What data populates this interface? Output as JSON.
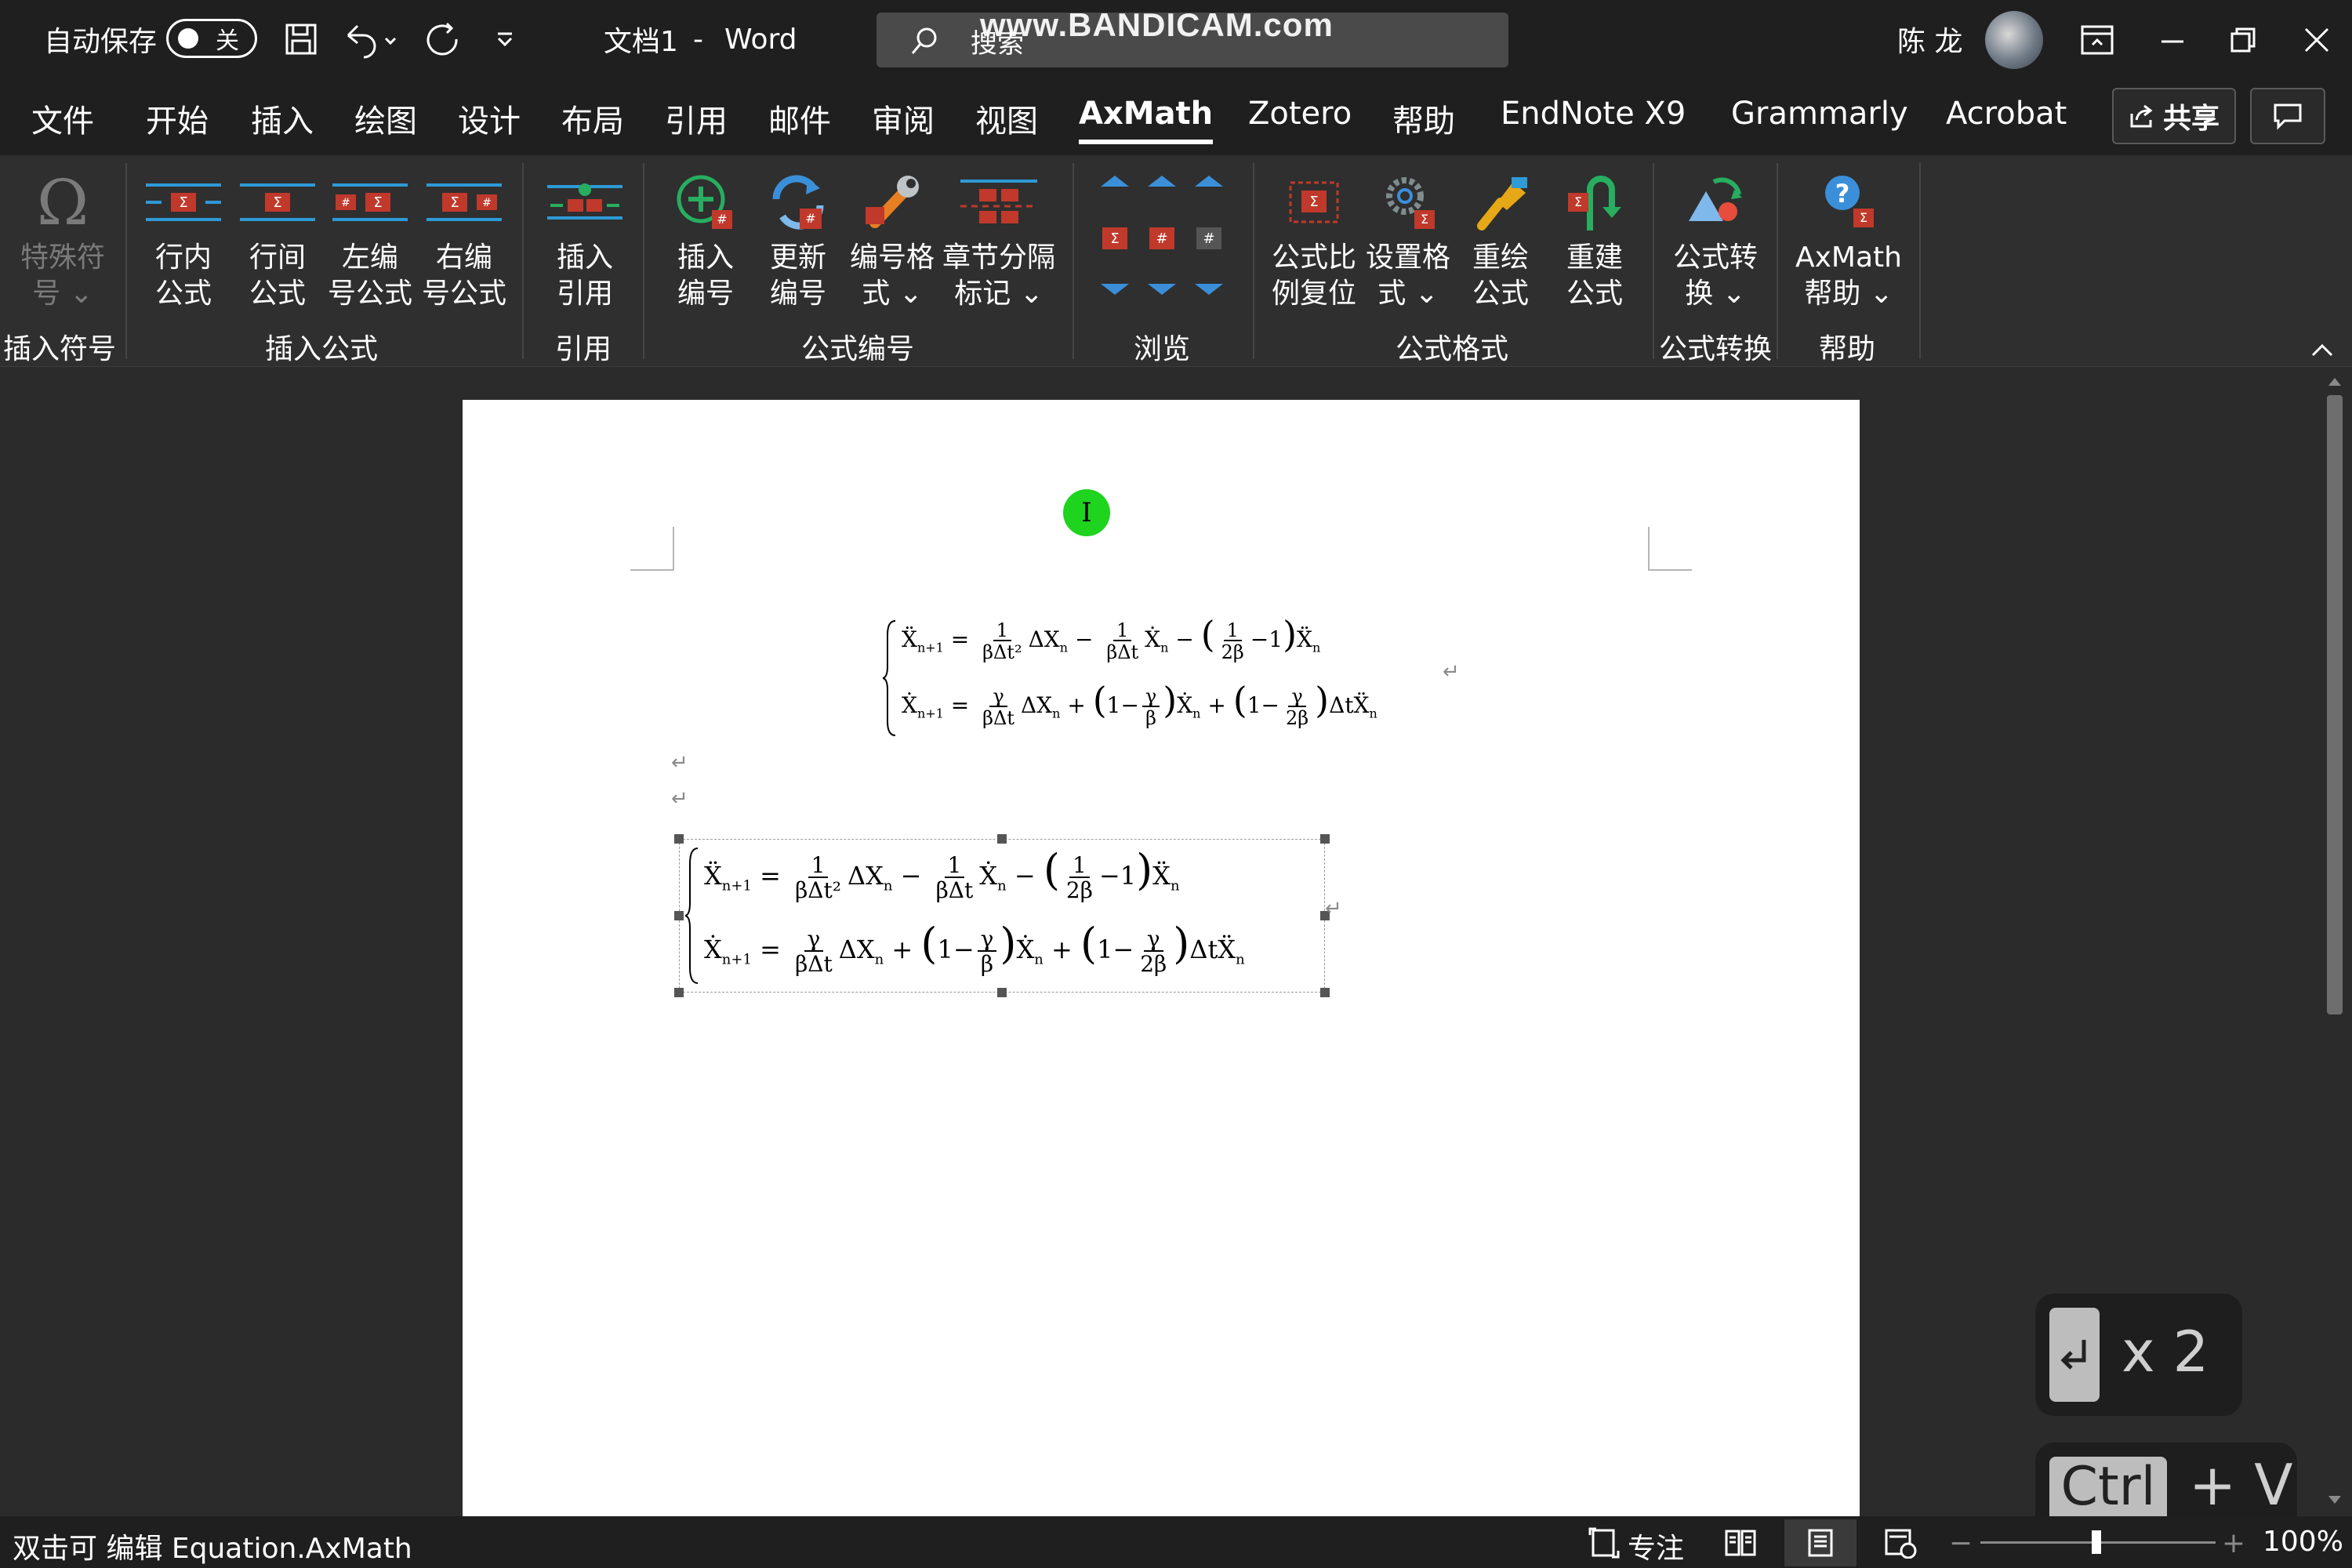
{
  "titlebar": {
    "autosave_label": "自动保存",
    "autosave_state": "关",
    "doc_title": "文档1",
    "title_sep": "-",
    "app_name": "Word",
    "search_placeholder": "搜索",
    "watermark": "www.BANDICAM.com",
    "user_name": "陈 龙"
  },
  "tabs": [
    "文件",
    "开始",
    "插入",
    "绘图",
    "设计",
    "布局",
    "引用",
    "邮件",
    "审阅",
    "视图",
    "AxMath",
    "Zotero",
    "帮助",
    "EndNote X9",
    "Grammarly",
    "Acrobat"
  ],
  "active_tab": "AxMath",
  "share_label": "共享",
  "ribbon": {
    "special_symbol": {
      "line1": "特殊符",
      "line2": "号 ⌄"
    },
    "inline_formula": {
      "line1": "行内",
      "line2": "公式"
    },
    "display_formula": {
      "line1": "行间",
      "line2": "公式"
    },
    "left_numbered": {
      "line1": "左编",
      "line2": "号公式"
    },
    "right_numbered": {
      "line1": "右编",
      "line2": "号公式"
    },
    "insert_ref": {
      "line1": "插入",
      "line2": "引用"
    },
    "insert_number": {
      "line1": "插入",
      "line2": "编号"
    },
    "update_number": {
      "line1": "更新",
      "line2": "编号"
    },
    "number_format": {
      "line1": "编号格",
      "line2": "式 ⌄"
    },
    "chapter_mark": {
      "line1": "章节分隔",
      "line2": "标记 ⌄"
    },
    "scale_reset": {
      "line1": "公式比",
      "line2": "例复位"
    },
    "set_format": {
      "line1": "设置格",
      "line2": "式 ⌄"
    },
    "redraw": {
      "line1": "重绘",
      "line2": "公式"
    },
    "rebuild": {
      "line1": "重建",
      "line2": "公式"
    },
    "convert": {
      "line1": "公式转",
      "line2": "换 ⌄"
    },
    "help": {
      "line1": "AxMath",
      "line2": "帮助 ⌄"
    },
    "groups": {
      "insert_symbol": "插入符号",
      "insert_formula": "插入公式",
      "reference": "引用",
      "formula_number": "公式编号",
      "browse": "浏览",
      "formula_format": "公式格式",
      "formula_convert": "公式转换",
      "help": "帮助"
    }
  },
  "document": {
    "eq1": {
      "line1": {
        "lhs": "Ẍ",
        "sub": "n+1",
        "t1_num": "1",
        "t1_den": "βΔt²",
        "t1_var": "ΔX",
        "t2_num": "1",
        "t2_den": "βΔt",
        "t2_var": "Ẋ",
        "t3_num": "1",
        "t3_den": "2β",
        "t3_tail": "−1",
        "t3_var": "Ẍ"
      },
      "line2": {
        "lhs": "Ẋ",
        "sub": "n+1",
        "t1_num": "γ",
        "t1_den": "βΔt",
        "t1_var": "ΔX",
        "t2_num": "γ",
        "t2_den": "β",
        "t2_var": "Ẋ",
        "t3_num": "γ",
        "t3_den": "2β",
        "t3_var": "ΔtẌ"
      }
    },
    "para_mark": "↵"
  },
  "key_overlay": {
    "enter_count": "x 2",
    "ctrl_label": "Ctrl",
    "plus_v": "+ V"
  },
  "statusbar": {
    "status_text": "双击可 编辑 Equation.AxMath",
    "focus_label": "专注",
    "zoom_level": "100%"
  }
}
